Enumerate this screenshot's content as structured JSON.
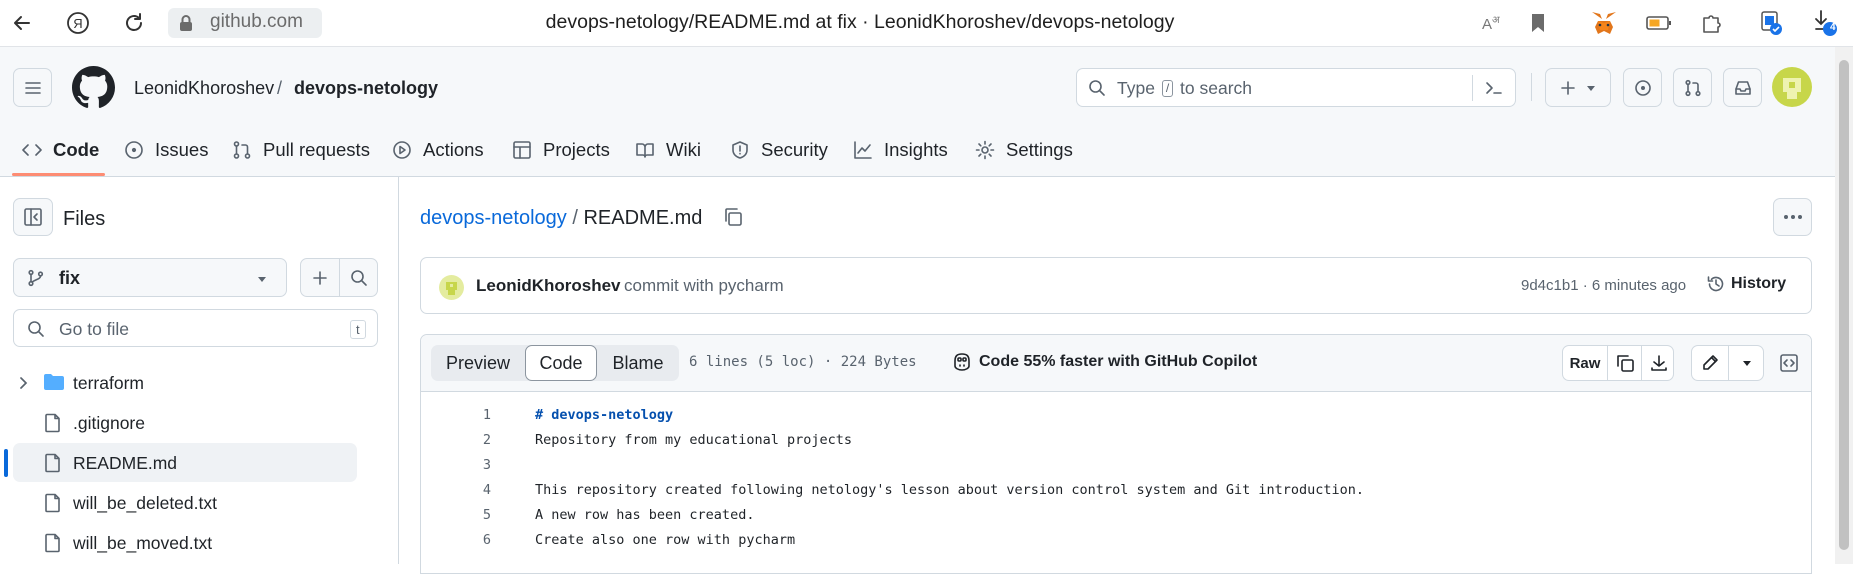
{
  "browser": {
    "url": "github.com",
    "title": "devops-netology/README.md at fix · LeonidKhoroshev/devops-netology",
    "download_badge": "4"
  },
  "header": {
    "owner": "LeonidKhoroshev",
    "separator": "/",
    "repo": "devops-netology",
    "search_placeholder_pre": "Type",
    "search_key": "/",
    "search_placeholder_post": "to search",
    "new_button": "+"
  },
  "tabs": [
    {
      "label": "Code",
      "icon": "code-icon"
    },
    {
      "label": "Issues",
      "icon": "issue-icon"
    },
    {
      "label": "Pull requests",
      "icon": "pull-request-icon"
    },
    {
      "label": "Actions",
      "icon": "play-icon"
    },
    {
      "label": "Projects",
      "icon": "table-icon"
    },
    {
      "label": "Wiki",
      "icon": "book-icon"
    },
    {
      "label": "Security",
      "icon": "shield-icon"
    },
    {
      "label": "Insights",
      "icon": "graph-icon"
    },
    {
      "label": "Settings",
      "icon": "gear-icon"
    }
  ],
  "sidebar": {
    "title": "Files",
    "branch": "fix",
    "goto_placeholder": "Go to file",
    "goto_key": "t",
    "tree": [
      {
        "name": "terraform",
        "type": "folder"
      },
      {
        "name": ".gitignore",
        "type": "file"
      },
      {
        "name": "README.md",
        "type": "file",
        "selected": true
      },
      {
        "name": "will_be_deleted.txt",
        "type": "file"
      },
      {
        "name": "will_be_moved.txt",
        "type": "file"
      }
    ]
  },
  "breadcrumb": {
    "repo": "devops-netology",
    "separator": "/",
    "file": "README.md"
  },
  "commit": {
    "author": "LeonidKhoroshev",
    "message": "commit with pycharm",
    "hash_time": "9d4c1b1 · 6 minutes ago",
    "history_label": "History"
  },
  "file_view": {
    "tabs": [
      "Preview",
      "Code",
      "Blame"
    ],
    "active_tab": "Code",
    "meta": "6 lines (5 loc) · 224 Bytes",
    "copilot": "Code 55% faster with GitHub Copilot",
    "raw_label": "Raw"
  },
  "code_lines": [
    {
      "n": "1",
      "text": "# devops-netology",
      "heading": true
    },
    {
      "n": "2",
      "text": "Repository from my educational projects"
    },
    {
      "n": "3",
      "text": ""
    },
    {
      "n": "4",
      "text": "This repository created following netology's lesson about version control system and Git introduction."
    },
    {
      "n": "5",
      "text": "A new row has been created."
    },
    {
      "n": "6",
      "text": "Create also one row with pycharm"
    }
  ]
}
